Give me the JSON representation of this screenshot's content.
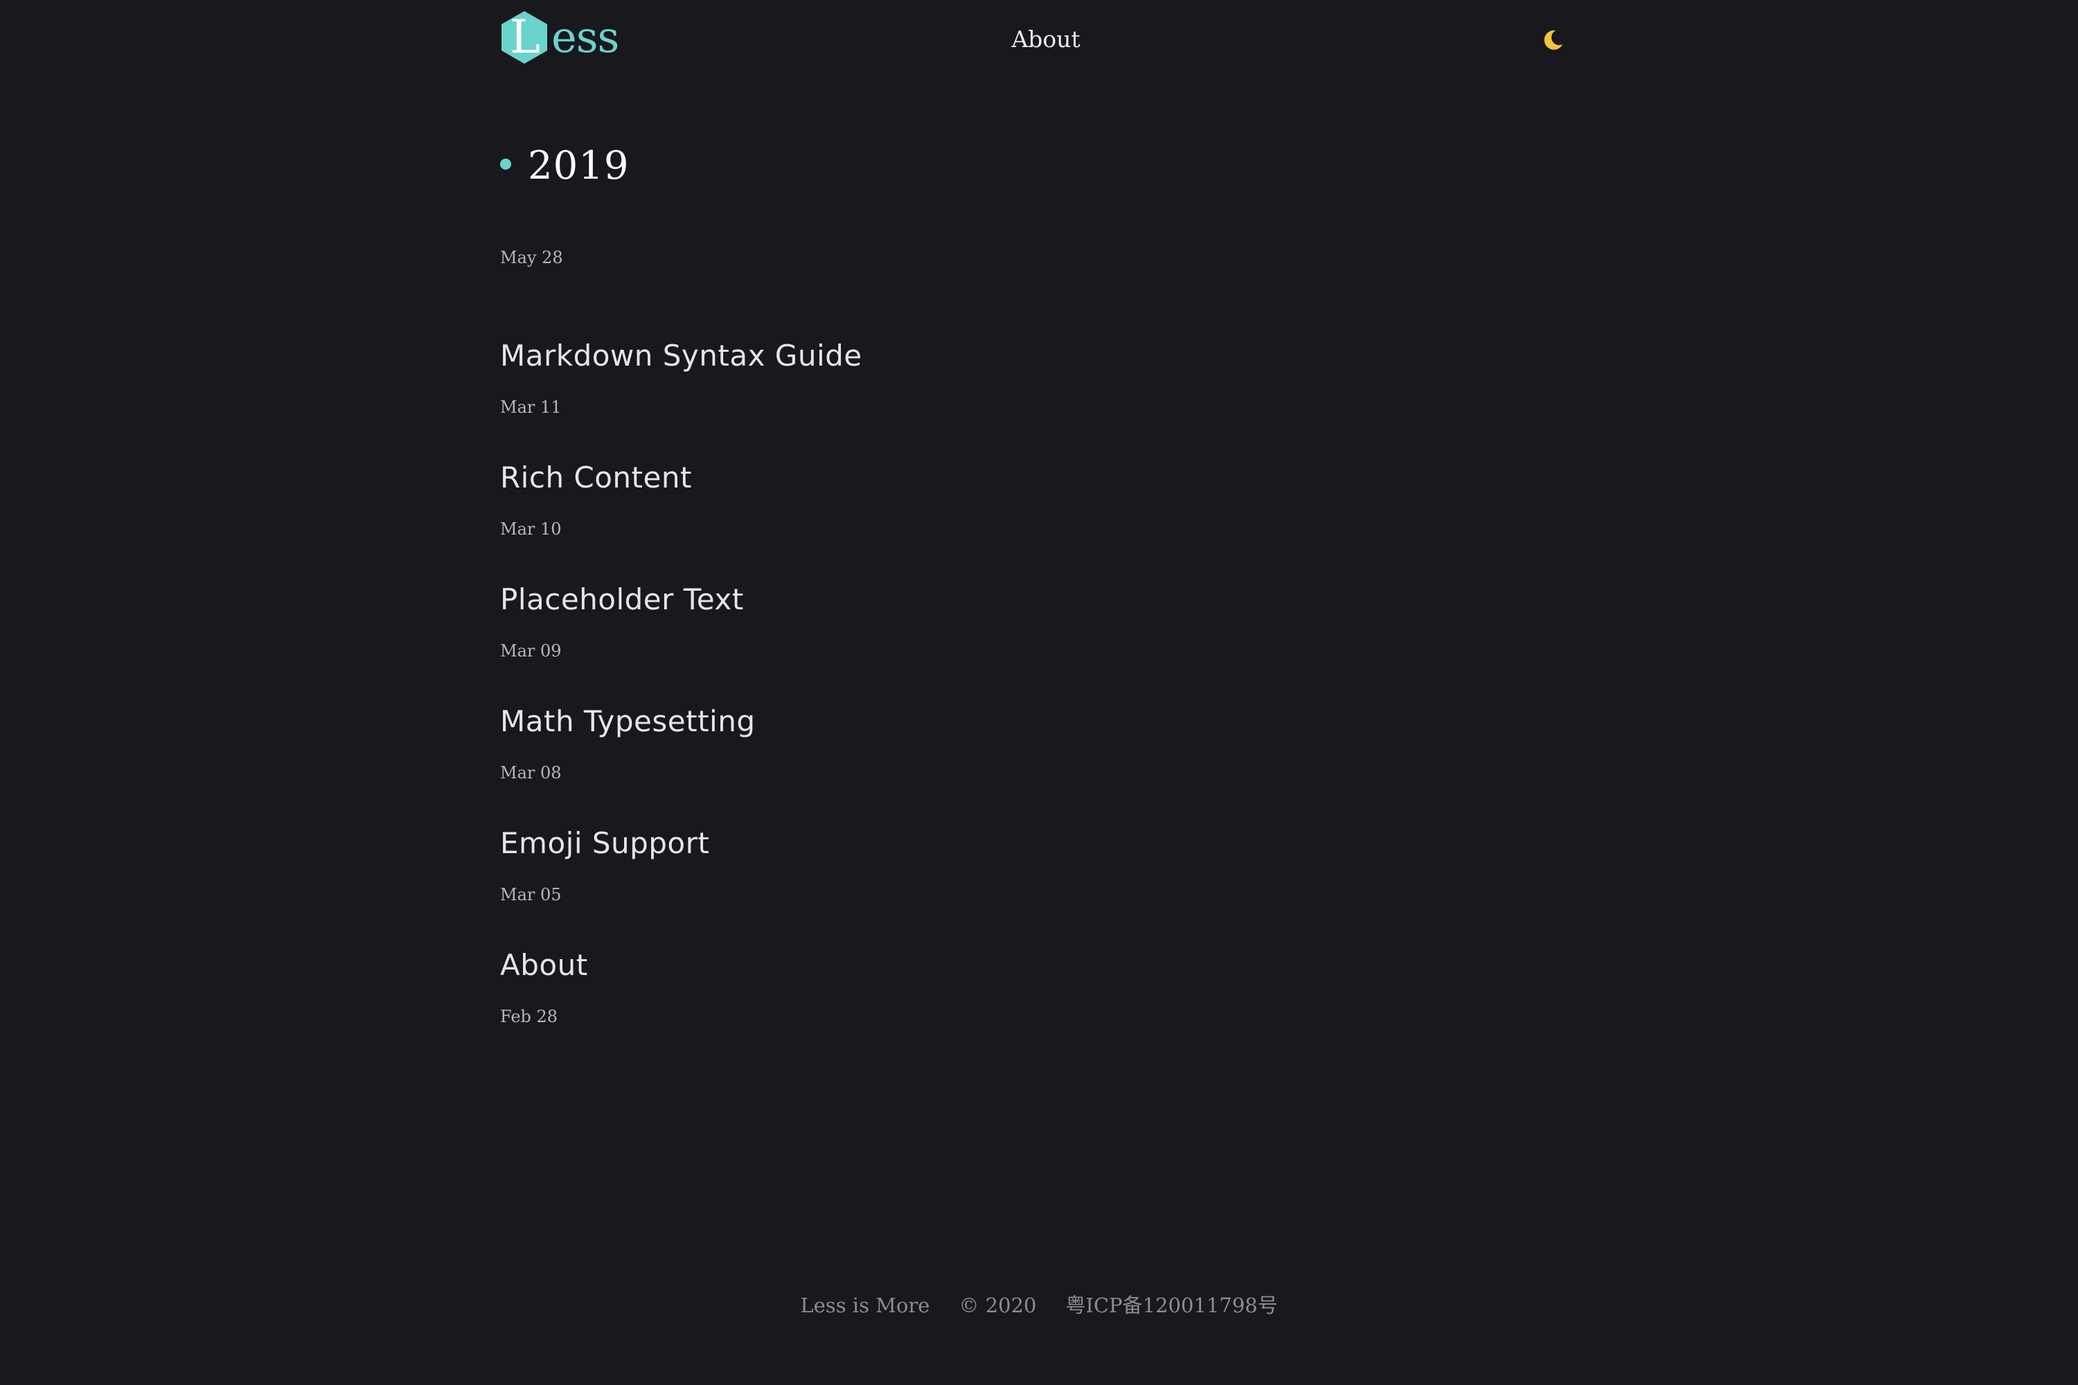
{
  "header": {
    "logo_letter": "L",
    "logo_rest": "ess",
    "nav_about": "About",
    "theme_icon": "moon-icon"
  },
  "colors": {
    "background": "#18181d",
    "accent": "#6ad3cc",
    "moon": "#f3c33d",
    "text": "#e6e6e6",
    "muted": "#b7b7b7",
    "footer": "#8d8d8d"
  },
  "archive": {
    "year": "2019",
    "first_date": "May 28",
    "posts": [
      {
        "title": "Markdown Syntax Guide",
        "date": "Mar 11"
      },
      {
        "title": "Rich Content",
        "date": "Mar 10"
      },
      {
        "title": "Placeholder Text",
        "date": "Mar 09"
      },
      {
        "title": "Math Typesetting",
        "date": "Mar 08"
      },
      {
        "title": "Emoji Support",
        "date": "Mar 05"
      },
      {
        "title": "About",
        "date": "Feb 28"
      }
    ]
  },
  "footer": {
    "tagline": "Less is More",
    "copyright": "© 2020",
    "icp": "粤ICP备120011798号"
  }
}
